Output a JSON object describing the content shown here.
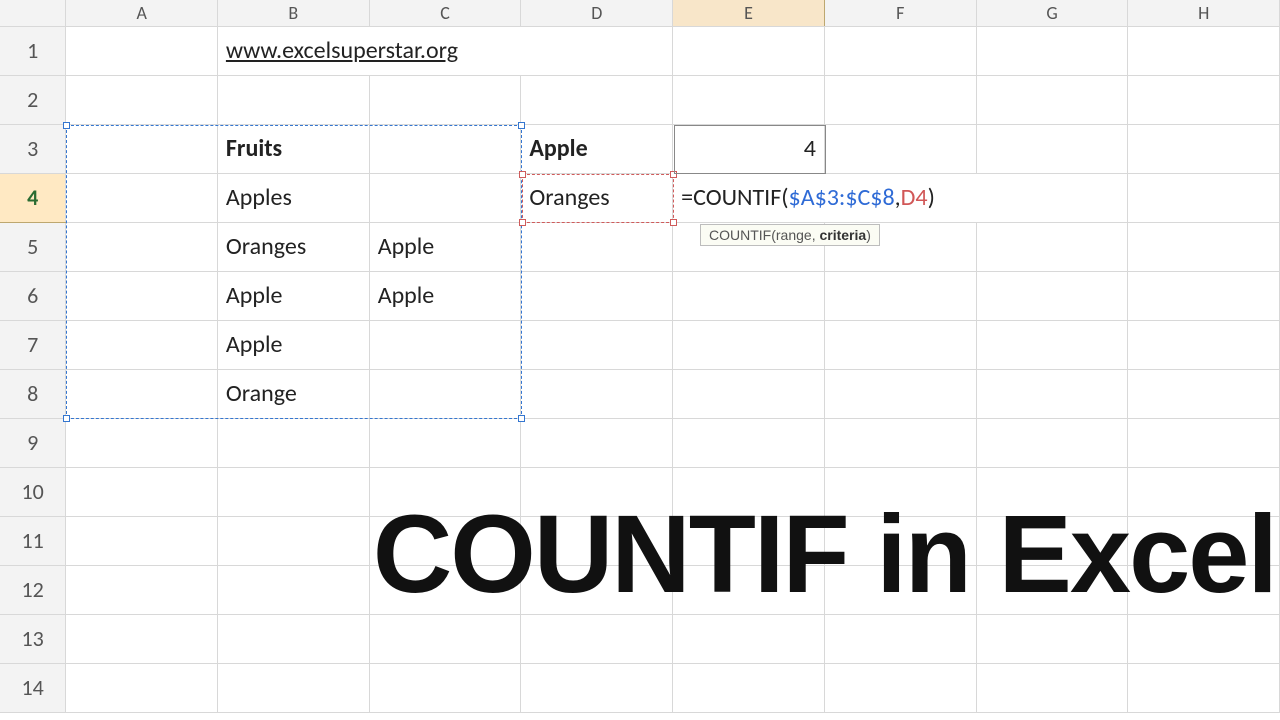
{
  "columns": [
    "A",
    "B",
    "C",
    "D",
    "E",
    "F",
    "G",
    "H"
  ],
  "rows": [
    "1",
    "2",
    "3",
    "4",
    "5",
    "6",
    "7",
    "8",
    "9",
    "10",
    "11",
    "12",
    "13",
    "14"
  ],
  "active_col_index": 4,
  "active_row_index": 3,
  "cells": {
    "B1": "www.excelsuperstar.org",
    "B3": "Fruits",
    "B4": "Apples",
    "B5": "Oranges",
    "C5": "Apple",
    "B6": "Apple",
    "C6": "Apple",
    "B7": "Apple",
    "B8": "Orange",
    "D3": "Apple",
    "D4": "Oranges",
    "E3": "4"
  },
  "formula": {
    "prefix": "=",
    "fn": "COUNTIF",
    "open": "(",
    "ref1": "$A$3:$C$8",
    "comma": ",",
    "ref2": "D4",
    "close": ")"
  },
  "tooltip": {
    "fn": "COUNTIF(",
    "arg1": "range",
    "sep": ", ",
    "arg2": "criteria",
    "close": ")"
  },
  "overlay_title": "COUNTIF in Excel"
}
